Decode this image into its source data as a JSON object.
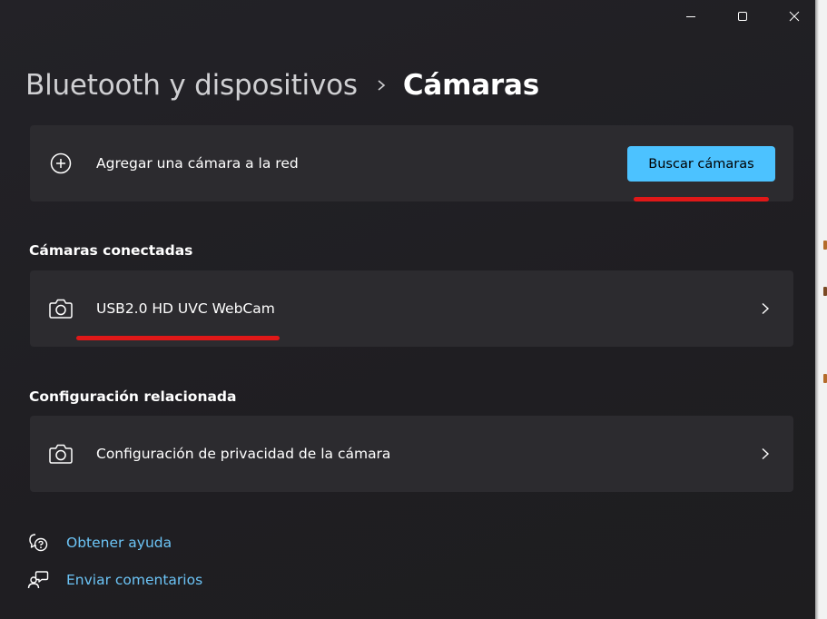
{
  "window": {
    "controls": {
      "minimize": "minimize-icon",
      "maximize": "maximize-icon",
      "close": "close-icon"
    }
  },
  "breadcrumb": {
    "parent": "Bluetooth y dispositivos",
    "current": "Cámaras"
  },
  "add_camera": {
    "label": "Agregar una cámara a la red",
    "button_label": "Buscar cámaras",
    "icon": "add-circle-icon"
  },
  "connected": {
    "section_title": "Cámaras conectadas",
    "items": [
      {
        "label": "USB2.0 HD UVC WebCam",
        "icon": "camera-icon"
      }
    ]
  },
  "related": {
    "section_title": "Configuración relacionada",
    "items": [
      {
        "label": "Configuración de privacidad de la cámara",
        "icon": "camera-icon"
      }
    ]
  },
  "links": {
    "help": "Obtener ayuda",
    "feedback": "Enviar comentarios"
  },
  "colors": {
    "accent": "#4cc2ff",
    "link": "#6cc4f6",
    "card_bg": "#2c2b2f",
    "window_bg": "#201f22",
    "annotation": "#e01818"
  }
}
